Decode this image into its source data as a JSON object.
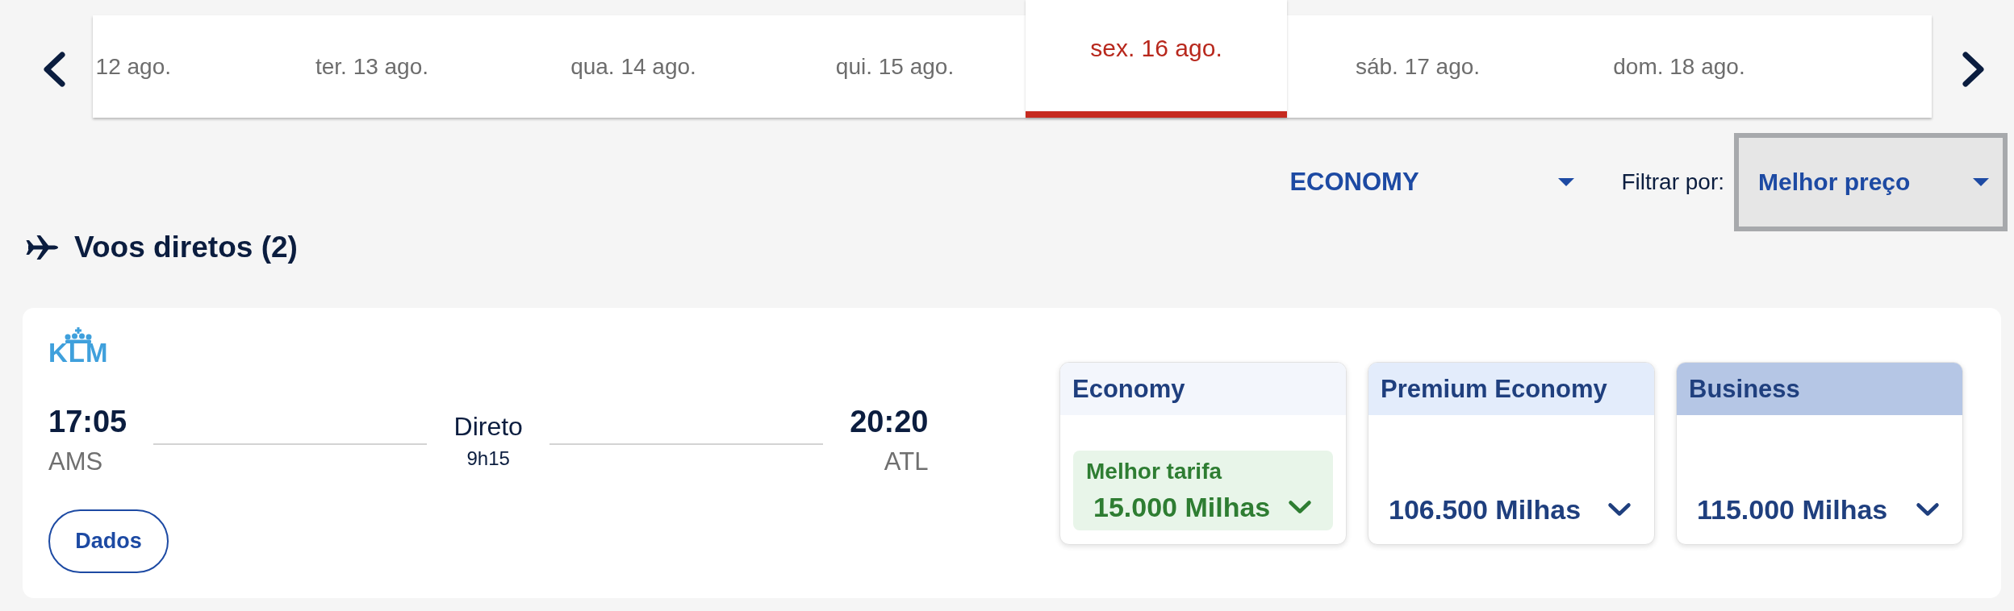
{
  "date_nav": {
    "dates": [
      {
        "label": "12 ago.",
        "selected": false
      },
      {
        "label": "ter. 13 ago.",
        "selected": false
      },
      {
        "label": "qua. 14 ago.",
        "selected": false
      },
      {
        "label": "qui. 15 ago.",
        "selected": false
      },
      {
        "label": "sex. 16 ago.",
        "selected": true
      },
      {
        "label": "sáb. 17 ago.",
        "selected": false
      },
      {
        "label": "dom. 18 ago.",
        "selected": false
      }
    ]
  },
  "cabin_select": {
    "value": "ECONOMY",
    "focused": false
  },
  "filter": {
    "label": "Filtrar por:",
    "value": "Melhor preço",
    "focused": true
  },
  "section": {
    "title": "Voos diretos (2)"
  },
  "flights": [
    {
      "airline": "KLM",
      "departure": {
        "time": "17:05",
        "airport": "AMS"
      },
      "stops": "Direto",
      "duration": "9h15",
      "arrival": {
        "time": "20:20",
        "airport": "ATL"
      },
      "details_button": "Dados",
      "fares": [
        {
          "name": "Economy",
          "color": "#f3f6fc",
          "best": true,
          "badge": "Melhor tarifa",
          "price": "15.000 Milhas"
        },
        {
          "name": "Premium Economy",
          "color": "#e3ecfb",
          "best": false,
          "price": "106.500 Milhas"
        },
        {
          "name": "Business",
          "color": "#b5c6e5",
          "best": false,
          "price": "115.000 Milhas"
        }
      ]
    }
  ]
}
